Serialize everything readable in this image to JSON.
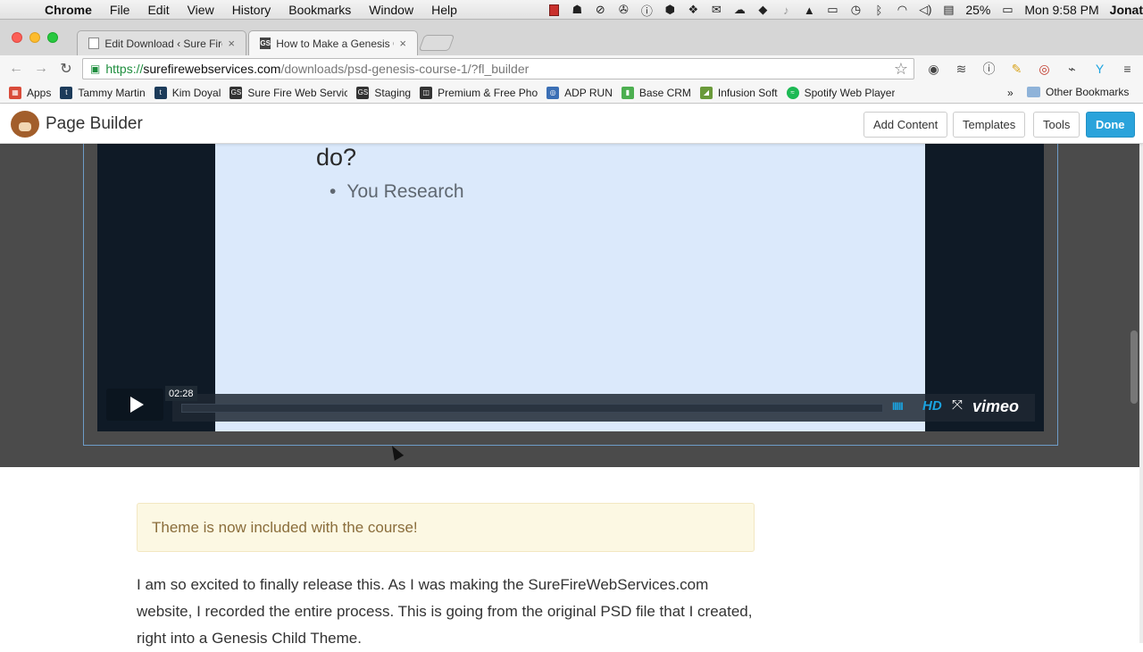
{
  "menubar": {
    "app": "Chrome",
    "items": [
      "File",
      "Edit",
      "View",
      "History",
      "Bookmarks",
      "Window",
      "Help"
    ],
    "status_icons": [
      "red-square-icon",
      "bowler-hat-icon",
      "circle-slash-icon",
      "fan-icon",
      "info-icon",
      "box-icon",
      "dropbox-icon",
      "mail-icon",
      "cloud-icon",
      "evernote-icon",
      "bell-icon",
      "google-drive-icon",
      "airplay-icon",
      "time-machine-icon",
      "bluetooth-icon",
      "wifi-icon",
      "volume-icon",
      "input-icon"
    ],
    "battery": "25%",
    "clock": "Mon 9:58 PM",
    "user": "Jonat"
  },
  "tabs": [
    {
      "label": "Edit Download ‹ Sure Fire W",
      "active": false
    },
    {
      "label": "How to Make a Genesis Ch",
      "active": true
    }
  ],
  "omnibox": {
    "scheme": "https://",
    "host": "surefirewebservices.com",
    "path": "/downloads/psd-genesis-course-1/?fl_builder"
  },
  "bookmarks": {
    "items": [
      {
        "label": "Apps",
        "color": "#d94b3a"
      },
      {
        "label": "Tammy Martin",
        "color": "#1c3b5a"
      },
      {
        "label": "Kim Doyal",
        "color": "#1c3b5a"
      },
      {
        "label": "Sure Fire Web Servic",
        "color": "#333333"
      },
      {
        "label": "Staging",
        "color": "#333333"
      },
      {
        "label": "Premium & Free Pho",
        "color": "#333333"
      },
      {
        "label": "ADP RUN",
        "color": "#3b6fb5"
      },
      {
        "label": "Base CRM",
        "color": "#4caf50"
      },
      {
        "label": "Infusion Soft",
        "color": "#6a9a3a"
      },
      {
        "label": "Spotify Web Player",
        "color": "#1db954"
      }
    ],
    "more": "»",
    "other": "Other Bookmarks"
  },
  "page_builder": {
    "title": "Page Builder",
    "add_content": "Add Content",
    "templates": "Templates",
    "tools": "Tools",
    "done": "Done"
  },
  "video": {
    "slide_line1": "do?",
    "slide_bullet": "You Research",
    "time": "02:28",
    "hd": "HD",
    "brand": "vimeo",
    "colors": {
      "accent": "#1aa3e0",
      "slide_bg": "#dbe9fb"
    }
  },
  "content": {
    "notice": "Theme is now included with the course!",
    "paragraph": "I am so excited to finally release this. As I was making the SureFireWebServices.com website, I recorded the entire process. This is going from the original PSD file that I created, right into a Genesis Child Theme."
  }
}
